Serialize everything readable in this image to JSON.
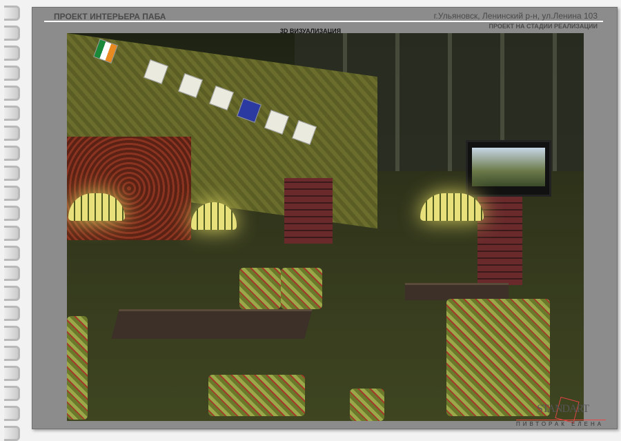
{
  "header": {
    "title": "ПРОЕКТ ИНТЕРЬЕРА ПАБА",
    "address": "г.Ульяновск, Ленинский р-н, ул.Ленина 103",
    "stage": "ПРОЕКТ НА СТАДИИ РЕАЛИЗАЦИИ",
    "section": "3D ВИЗУАЛИЗАЦИЯ"
  },
  "logo": {
    "wordmark": "STANDART",
    "author": "ПИВТОРАК ЕЛЕНА"
  },
  "colors": {
    "panel": "#8c8c8c",
    "accent": "#e44444",
    "text": "#4a4a4a"
  }
}
